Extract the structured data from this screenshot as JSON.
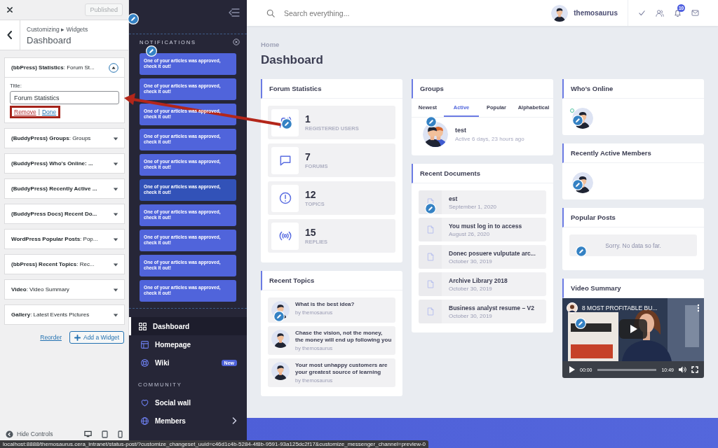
{
  "customizer": {
    "publish_button": {
      "label": "Published",
      "disabled": true
    },
    "breadcrumb": "Customizing ▸ Widgets",
    "title": "Dashboard",
    "widgets": [
      {
        "label": "**(bbPress) Statistics**: Forum St...",
        "expanded": true,
        "field_label": "Title:",
        "field_value": "Forum Statistics",
        "remove": "Remove",
        "separator": "|",
        "done": "Done"
      },
      {
        "label": "**(BuddyPress) Groups**: Groups",
        "expanded": false
      },
      {
        "label": "**(BuddyPress) Who's Online: ...**",
        "expanded": false
      },
      {
        "label": "**(BuddyPress) Recently Active ...**",
        "expanded": false
      },
      {
        "label": "**(BuddyPress Docs) Recent Do...**",
        "expanded": false
      },
      {
        "label": "**WordPress Popular Posts**: Pop...",
        "expanded": false
      },
      {
        "label": "**(bbPress) Recent Topics**: Rec...",
        "expanded": false
      },
      {
        "label": "**Video**: Video Summary",
        "expanded": false
      },
      {
        "label": "**Gallery**: Latest Events Pictures",
        "expanded": false
      }
    ],
    "reorder": "Reorder",
    "add_widget": "Add a Widget",
    "hide_controls": "Hide Controls"
  },
  "sidebar": {
    "notifications_title": "NOTIFICATIONS",
    "notifications": [
      {
        "text": "One of your articles was approved, check it out!",
        "highlighted": false
      },
      {
        "text": "One of your articles was approved, check it out!",
        "highlighted": false
      },
      {
        "text": "One of your articles was approved, check it out!",
        "highlighted": false
      },
      {
        "text": "One of your articles was approved, check it out!",
        "highlighted": false
      },
      {
        "text": "One of your articles was approved, check it out!",
        "highlighted": false
      },
      {
        "text": "One of your articles was approved, check it out!",
        "highlighted": true
      },
      {
        "text": "One of your articles was approved, check it out!",
        "highlighted": false
      },
      {
        "text": "One of your articles was approved, check it out!",
        "highlighted": false
      },
      {
        "text": "One of your articles was approved, check it out!",
        "highlighted": false
      },
      {
        "text": "One of your articles was approved, check it out!",
        "highlighted": false
      }
    ],
    "nav": [
      {
        "label": "Dashboard",
        "selected": true
      },
      {
        "label": "Homepage",
        "selected": false
      },
      {
        "label": "Wiki",
        "selected": false,
        "badge": "New"
      }
    ],
    "section": "COMMUNITY",
    "community": [
      {
        "label": "Social wall",
        "selected": false,
        "submenu": false
      },
      {
        "label": "Members",
        "selected": false,
        "submenu": true
      }
    ]
  },
  "topbar": {
    "search_placeholder": "Search everything...",
    "user": "themosaurus",
    "notification_count": "10"
  },
  "breadcrumb": "Home",
  "page_title": "Dashboard",
  "forum_statistics": {
    "title": "Forum Statistics",
    "stats": [
      {
        "value": "1",
        "label": "REGISTERED USERS"
      },
      {
        "value": "7",
        "label": "FORUMS"
      },
      {
        "value": "12",
        "label": "TOPICS"
      },
      {
        "value": "15",
        "label": "REPLIES"
      }
    ]
  },
  "recent_topics": {
    "title": "Recent Topics",
    "items": [
      {
        "title": "What is the best idea?",
        "author": "by themosaurus"
      },
      {
        "title": "Chase the vision, not the money, the money will end up following you",
        "author": "by themosaurus"
      },
      {
        "title": "Your most unhappy customers are your greatest source of learning",
        "author": "by themosaurus"
      }
    ]
  },
  "groups": {
    "title": "Groups",
    "tabs": [
      {
        "label": "Newest",
        "selected": false
      },
      {
        "label": "Active",
        "selected": true
      },
      {
        "label": "Popular",
        "selected": false
      },
      {
        "label": "Alphabetical",
        "selected": false
      }
    ],
    "items": [
      {
        "name": "test",
        "activity": "Active 6 days, 23 hours ago"
      }
    ]
  },
  "recent_documents": {
    "title": "Recent Documents",
    "items": [
      {
        "title": "est",
        "date": "September 1, 2020"
      },
      {
        "title": "You must log in to access",
        "date": "August 26, 2020"
      },
      {
        "title": "Donec posuere vulputate arc...",
        "date": "October 30, 2019"
      },
      {
        "title": "Archive Library 2018",
        "date": "October 30, 2019"
      },
      {
        "title": "Business analyst resume – V2",
        "date": "October 30, 2019"
      }
    ]
  },
  "whos_online": {
    "title": "Who’s Online",
    "members": [
      {
        "online": true
      }
    ]
  },
  "recently_active": {
    "title": "Recently Active Members",
    "members": [
      {
        "online": false
      }
    ]
  },
  "popular_posts": {
    "title": "Popular Posts",
    "empty_message": "Sorry. No data so far."
  },
  "video_summary": {
    "title": "Video Summary",
    "video": {
      "kind": "picture",
      "title": "8 MOST PROFITABLE BU...",
      "current_time": "00:00",
      "duration": "10:49",
      "level": 0
    }
  },
  "status_bar": "localhost:8888/themosaurus.cera_intranet/status-post/?customize_changeset_uuid=c46d1c4b-5284-4f8b-9591-93a125dc2f17&customize_messenger_channel=preview-0"
}
